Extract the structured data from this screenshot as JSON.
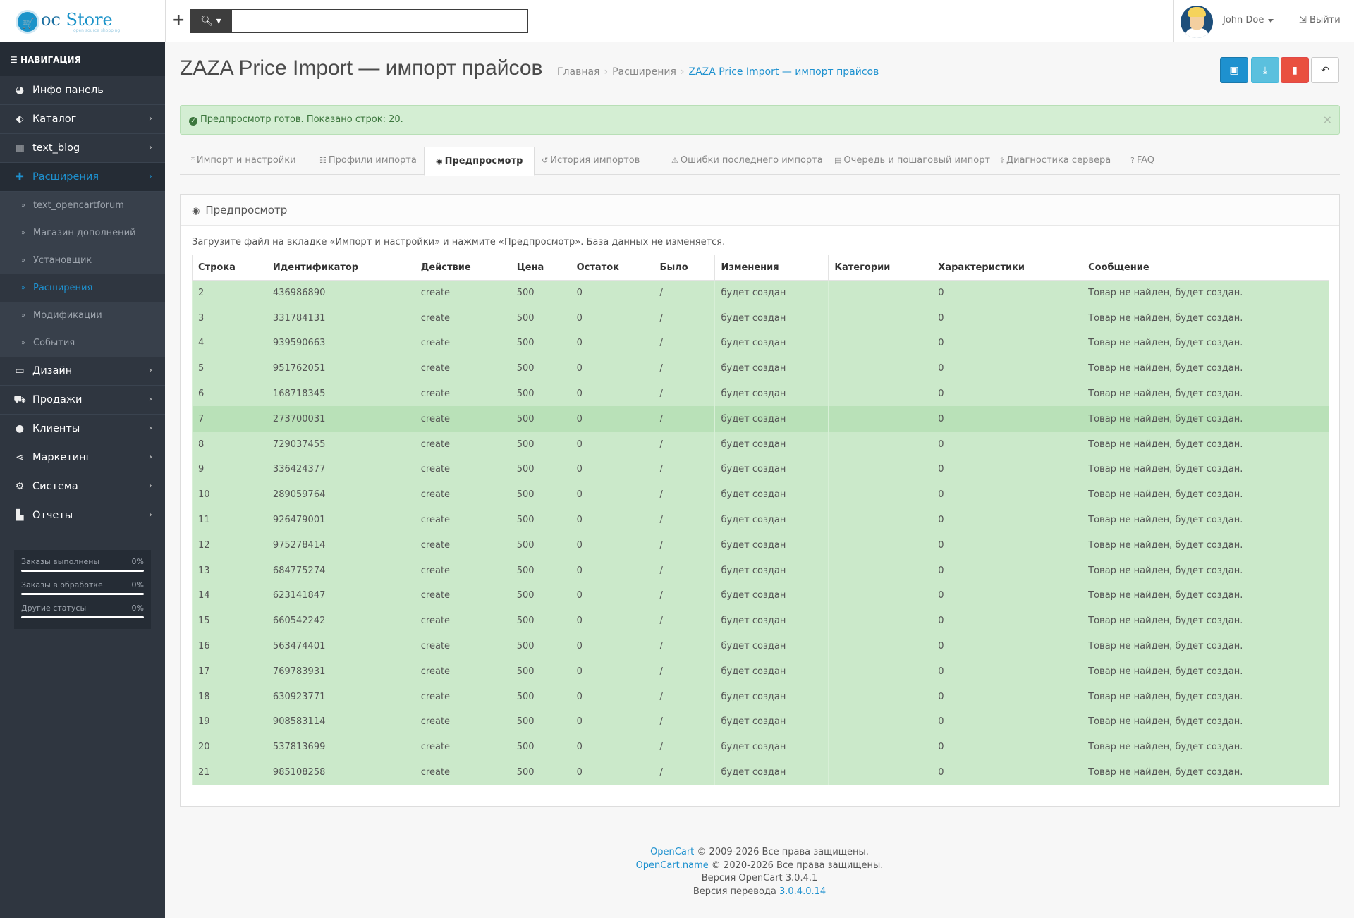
{
  "header": {
    "logo_oc": "oc",
    "logo_store": "Store",
    "logo_sub": "open source shopping",
    "search_placeholder": "",
    "user_name": "John Doe",
    "logout_label": "Выйти"
  },
  "sidebar": {
    "nav_title": "НАВИГАЦИЯ",
    "items": [
      {
        "label": "Инфо панель",
        "icon": "dashboard-icon"
      },
      {
        "label": "Каталог",
        "icon": "tags-icon"
      },
      {
        "label": "text_blog",
        "icon": "book-icon"
      },
      {
        "label": "Расширения",
        "icon": "puzzle-icon"
      },
      {
        "label": "Дизайн",
        "icon": "monitor-icon"
      },
      {
        "label": "Продажи",
        "icon": "cart-icon"
      },
      {
        "label": "Клиенты",
        "icon": "user-icon"
      },
      {
        "label": "Маркетинг",
        "icon": "share-icon"
      },
      {
        "label": "Система",
        "icon": "gear-icon"
      },
      {
        "label": "Отчеты",
        "icon": "bar-chart-icon"
      }
    ],
    "sub_items": [
      "text_opencartforum",
      "Магазин дополнений",
      "Установщик",
      "Расширения",
      "Модификации",
      "События"
    ],
    "stats": [
      {
        "label": "Заказы выполнены",
        "value": "0%"
      },
      {
        "label": "Заказы в обработке",
        "value": "0%"
      },
      {
        "label": "Другие статусы",
        "value": "0%"
      }
    ]
  },
  "page": {
    "title": "ZAZA Price Import — импорт прайсов",
    "breadcrumb": [
      "Главная",
      "Расширения",
      "ZAZA Price Import — импорт прайсов"
    ],
    "alert": "Предпросмотр готов. Показано строк: 20.",
    "alert_close": "×",
    "tabs": [
      {
        "label": "Импорт и настройки",
        "icon": "upload-icon"
      },
      {
        "label": "Профили импорта",
        "icon": "sliders-icon"
      },
      {
        "label": "Предпросмотр",
        "icon": "eye-icon"
      },
      {
        "label": "История импортов",
        "icon": "history-icon"
      },
      {
        "label": "Ошибки последнего импорта",
        "icon": "warning-icon"
      },
      {
        "label": "Очередь и пошаговый импорт",
        "icon": "list-icon"
      },
      {
        "label": "Диагностика сервера",
        "icon": "stethoscope-icon"
      },
      {
        "label": "FAQ",
        "icon": "question-icon"
      }
    ],
    "panel_title": "Предпросмотр",
    "hint": "Загрузите файл на вкладке «Импорт и настройки» и нажмите «Предпросмотр». База данных не изменяется."
  },
  "table": {
    "columns": [
      "Строка",
      "Идентификатор",
      "Действие",
      "Цена",
      "Остаток",
      "Было",
      "Изменения",
      "Категории",
      "Характеристики",
      "Сообщение"
    ],
    "rows": [
      [
        "2",
        "436986890",
        "create",
        "500",
        "0",
        "/",
        "будет создан",
        "",
        "0",
        "Товар не найден, будет создан."
      ],
      [
        "3",
        "331784131",
        "create",
        "500",
        "0",
        "/",
        "будет создан",
        "",
        "0",
        "Товар не найден, будет создан."
      ],
      [
        "4",
        "939590663",
        "create",
        "500",
        "0",
        "/",
        "будет создан",
        "",
        "0",
        "Товар не найден, будет создан."
      ],
      [
        "5",
        "951762051",
        "create",
        "500",
        "0",
        "/",
        "будет создан",
        "",
        "0",
        "Товар не найден, будет создан."
      ],
      [
        "6",
        "168718345",
        "create",
        "500",
        "0",
        "/",
        "будет создан",
        "",
        "0",
        "Товар не найден, будет создан."
      ],
      [
        "7",
        "273700031",
        "create",
        "500",
        "0",
        "/",
        "будет создан",
        "",
        "0",
        "Товар не найден, будет создан."
      ],
      [
        "8",
        "729037455",
        "create",
        "500",
        "0",
        "/",
        "будет создан",
        "",
        "0",
        "Товар не найден, будет создан."
      ],
      [
        "9",
        "336424377",
        "create",
        "500",
        "0",
        "/",
        "будет создан",
        "",
        "0",
        "Товар не найден, будет создан."
      ],
      [
        "10",
        "289059764",
        "create",
        "500",
        "0",
        "/",
        "будет создан",
        "",
        "0",
        "Товар не найден, будет создан."
      ],
      [
        "11",
        "926479001",
        "create",
        "500",
        "0",
        "/",
        "будет создан",
        "",
        "0",
        "Товар не найден, будет создан."
      ],
      [
        "12",
        "975278414",
        "create",
        "500",
        "0",
        "/",
        "будет создан",
        "",
        "0",
        "Товар не найден, будет создан."
      ],
      [
        "13",
        "684775274",
        "create",
        "500",
        "0",
        "/",
        "будет создан",
        "",
        "0",
        "Товар не найден, будет создан."
      ],
      [
        "14",
        "623141847",
        "create",
        "500",
        "0",
        "/",
        "будет создан",
        "",
        "0",
        "Товар не найден, будет создан."
      ],
      [
        "15",
        "660542242",
        "create",
        "500",
        "0",
        "/",
        "будет создан",
        "",
        "0",
        "Товар не найден, будет создан."
      ],
      [
        "16",
        "563474401",
        "create",
        "500",
        "0",
        "/",
        "будет создан",
        "",
        "0",
        "Товар не найден, будет создан."
      ],
      [
        "17",
        "769783931",
        "create",
        "500",
        "0",
        "/",
        "будет создан",
        "",
        "0",
        "Товар не найден, будет создан."
      ],
      [
        "18",
        "630923771",
        "create",
        "500",
        "0",
        "/",
        "будет создан",
        "",
        "0",
        "Товар не найден, будет создан."
      ],
      [
        "19",
        "908583114",
        "create",
        "500",
        "0",
        "/",
        "будет создан",
        "",
        "0",
        "Товар не найден, будет создан."
      ],
      [
        "20",
        "537813699",
        "create",
        "500",
        "0",
        "/",
        "будет создан",
        "",
        "0",
        "Товар не найден, будет создан."
      ],
      [
        "21",
        "985108258",
        "create",
        "500",
        "0",
        "/",
        "будет создан",
        "",
        "0",
        "Товар не найден, будет создан."
      ]
    ]
  },
  "footer": {
    "line1_link": "OpenCart",
    "line1_text": " © 2009-2026 Все права защищены.",
    "line2_link": "OpenCart.name",
    "line2_text": " © 2020-2026 Все права защищены.",
    "line3": "Версия OpenCart 3.0.4.1",
    "line4_text": "Версия перевода ",
    "line4_link": "3.0.4.0.14"
  },
  "colors": {
    "accent": "#1e91cf",
    "sidebar_bg": "#2f3640",
    "row_bg": "#cbe9ca",
    "alert_bg": "#d4eed3",
    "delete": "#e9503f"
  }
}
